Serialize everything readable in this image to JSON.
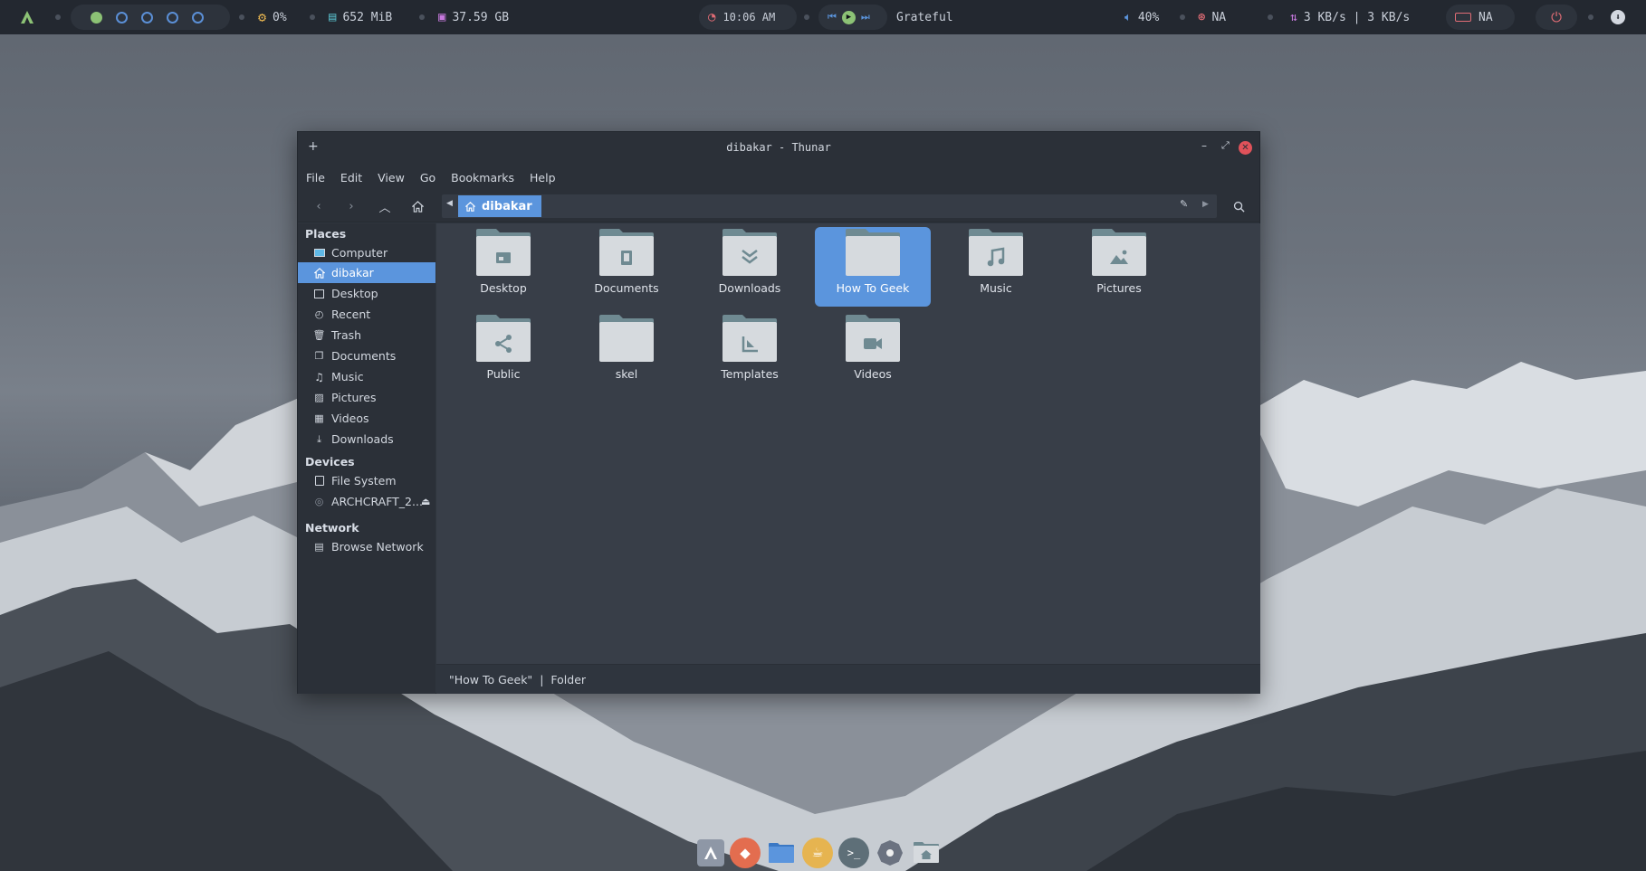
{
  "topbar": {
    "cpu": "0%",
    "ram": "652 MiB",
    "disk": "37.59 GB",
    "time": "10:06 AM",
    "track": "Grateful",
    "volume": "40%",
    "wifi": "NA",
    "network": "3 KB/s | 3 KB/s",
    "battery": "NA"
  },
  "window": {
    "title": "dibakar - Thunar",
    "menu": [
      "File",
      "Edit",
      "View",
      "Go",
      "Bookmarks",
      "Help"
    ],
    "path": "dibakar"
  },
  "sidebar": {
    "places_heading": "Places",
    "places": [
      "Computer",
      "dibakar",
      "Desktop",
      "Recent",
      "Trash",
      "Documents",
      "Music",
      "Pictures",
      "Videos",
      "Downloads"
    ],
    "devices_heading": "Devices",
    "devices": [
      "File System",
      "ARCHCRAFT_2..."
    ],
    "network_heading": "Network",
    "network": [
      "Browse Network"
    ]
  },
  "folders": [
    "Desktop",
    "Documents",
    "Downloads",
    "How To Geek",
    "Music",
    "Pictures",
    "Public",
    "skel",
    "Templates",
    "Videos"
  ],
  "status": {
    "name": "\"How To Geek\"",
    "sep": "|",
    "kind": "Folder"
  },
  "colors": {
    "accent": "#5b95dd",
    "close": "#e0525a",
    "folder_front": "#d6dade",
    "folder_back": "#6f8a92"
  }
}
